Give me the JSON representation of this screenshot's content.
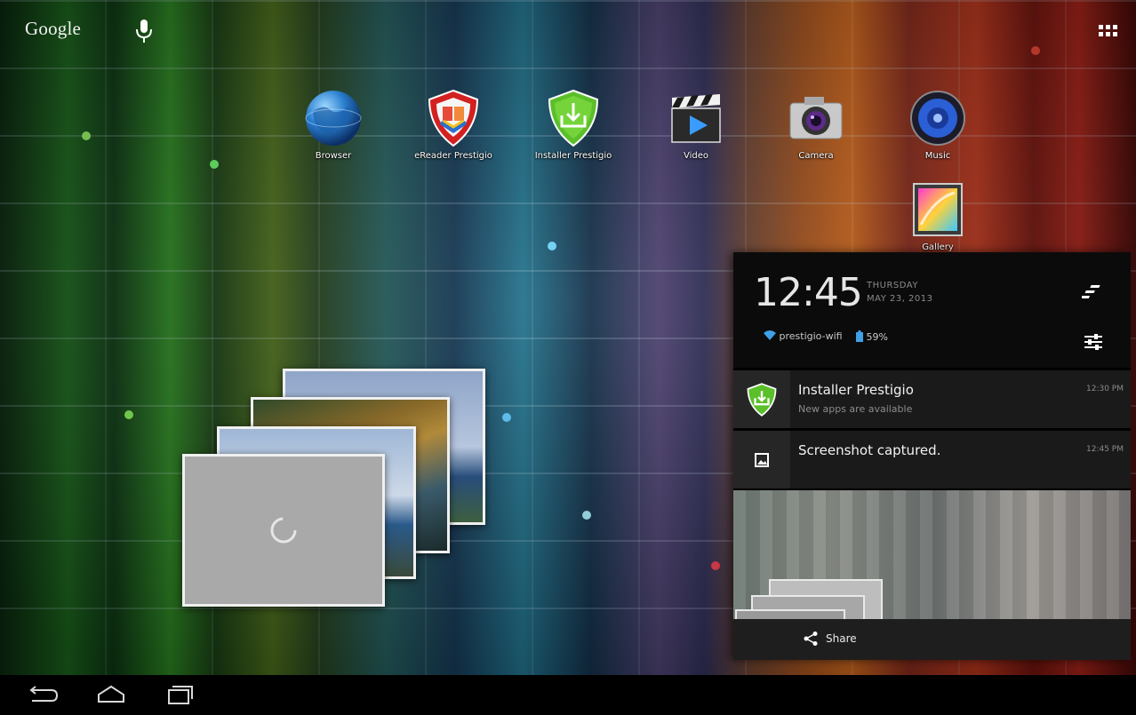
{
  "top_bar": {
    "search_label": "Google"
  },
  "apps": [
    {
      "label": "Browser"
    },
    {
      "label": "eReader Prestigio"
    },
    {
      "label": "Installer Prestigio"
    },
    {
      "label": "Video"
    },
    {
      "label": "Camera"
    },
    {
      "label": "Music"
    },
    {
      "label": "Gallery"
    }
  ],
  "notification_panel": {
    "time": "12:45",
    "day": "THURSDAY",
    "date": "MAY 23, 2013",
    "wifi_name": "prestigio-wifi",
    "battery": "59%",
    "notifications": [
      {
        "title": "Installer Prestigio",
        "text": "New apps are available",
        "time": "12:30 PM"
      },
      {
        "title": "Screenshot captured.",
        "text": "",
        "time": "12:45 PM"
      }
    ],
    "share_label": "Share"
  },
  "colors": {
    "panel_bg": "#000000",
    "notification_bg": "#1a1a1a",
    "installer_green": "#5bbf2a",
    "ereader_red": "#d32020"
  }
}
